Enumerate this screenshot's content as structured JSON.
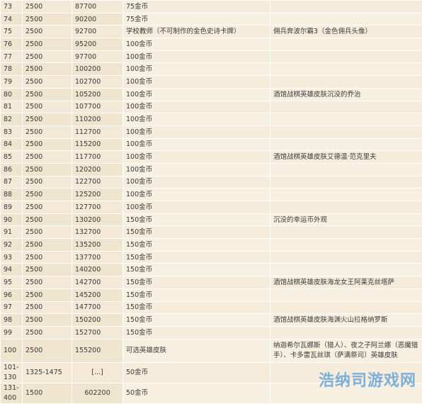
{
  "table": {
    "rows": [
      {
        "level": "73",
        "exp": "2500",
        "total": "87700",
        "reward": "75金币",
        "note": ""
      },
      {
        "level": "74",
        "exp": "2500",
        "total": "90200",
        "reward": "75金币",
        "note": ""
      },
      {
        "level": "75",
        "exp": "2500",
        "total": "92700",
        "reward": "学校教师（不可制作的金色史诗卡牌）",
        "note": "佣兵奔波尔霸3（金色佣兵头像）"
      },
      {
        "level": "76",
        "exp": "2500",
        "total": "95200",
        "reward": "100金币",
        "note": ""
      },
      {
        "level": "77",
        "exp": "2500",
        "total": "97700",
        "reward": "100金币",
        "note": ""
      },
      {
        "level": "78",
        "exp": "2500",
        "total": "100200",
        "reward": "100金币",
        "note": ""
      },
      {
        "level": "79",
        "exp": "2500",
        "total": "102700",
        "reward": "100金币",
        "note": ""
      },
      {
        "level": "80",
        "exp": "2500",
        "total": "105200",
        "reward": "100金币",
        "note": "酒馆战棋英雄皮肤沉没的乔治"
      },
      {
        "level": "81",
        "exp": "2500",
        "total": "107700",
        "reward": "100金币",
        "note": ""
      },
      {
        "level": "82",
        "exp": "2500",
        "total": "110200",
        "reward": "100金币",
        "note": ""
      },
      {
        "level": "83",
        "exp": "2500",
        "total": "112700",
        "reward": "100金币",
        "note": ""
      },
      {
        "level": "84",
        "exp": "2500",
        "total": "115200",
        "reward": "100金币",
        "note": ""
      },
      {
        "level": "85",
        "exp": "2500",
        "total": "117700",
        "reward": "100金币",
        "note": "酒馆战棋英雄皮肤艾德温·范克里夫"
      },
      {
        "level": "86",
        "exp": "2500",
        "total": "120200",
        "reward": "100金币",
        "note": ""
      },
      {
        "level": "87",
        "exp": "2500",
        "total": "122700",
        "reward": "100金币",
        "note": ""
      },
      {
        "level": "88",
        "exp": "2500",
        "total": "125200",
        "reward": "100金币",
        "note": ""
      },
      {
        "level": "89",
        "exp": "2500",
        "total": "127700",
        "reward": "100金币",
        "note": ""
      },
      {
        "level": "90",
        "exp": "2500",
        "total": "130200",
        "reward": "150金币",
        "note": "沉没的幸运币外观"
      },
      {
        "level": "91",
        "exp": "2500",
        "total": "132700",
        "reward": "150金币",
        "note": ""
      },
      {
        "level": "92",
        "exp": "2500",
        "total": "135200",
        "reward": "150金币",
        "note": ""
      },
      {
        "level": "93",
        "exp": "2500",
        "total": "137700",
        "reward": "150金币",
        "note": ""
      },
      {
        "level": "94",
        "exp": "2500",
        "total": "140200",
        "reward": "150金币",
        "note": ""
      },
      {
        "level": "95",
        "exp": "2500",
        "total": "142700",
        "reward": "150金币",
        "note": "酒馆战棋英雄皮肤海龙女王阿莱克丝塔萨"
      },
      {
        "level": "96",
        "exp": "2500",
        "total": "145200",
        "reward": "150金币",
        "note": ""
      },
      {
        "level": "97",
        "exp": "2500",
        "total": "147700",
        "reward": "150金币",
        "note": ""
      },
      {
        "level": "98",
        "exp": "2500",
        "total": "150200",
        "reward": "150金币",
        "note": "酒馆战棋英雄皮肤海渊火山拉格纳罗斯"
      },
      {
        "level": "99",
        "exp": "2500",
        "total": "152700",
        "reward": "150金币",
        "note": ""
      }
    ],
    "row100": {
      "level": "100",
      "exp": "2500",
      "total": "155200",
      "reward": "可选英雄皮肤",
      "note": "纳迦希尔瓦娜斯（猎人）、夜之子阿兰娜（恶魔猎手）、卡多雷瓦丝琪（萨满祭司）英雄皮肤"
    },
    "row101": {
      "level": "101-130",
      "exp": "1325-1475",
      "total": "[...]",
      "reward": "50金币",
      "note": ""
    },
    "row131": {
      "level": "131-400",
      "exp": "1500",
      "total": "602200",
      "reward": "50金币",
      "note": ""
    }
  },
  "watermark": "浩纳司游戏网"
}
